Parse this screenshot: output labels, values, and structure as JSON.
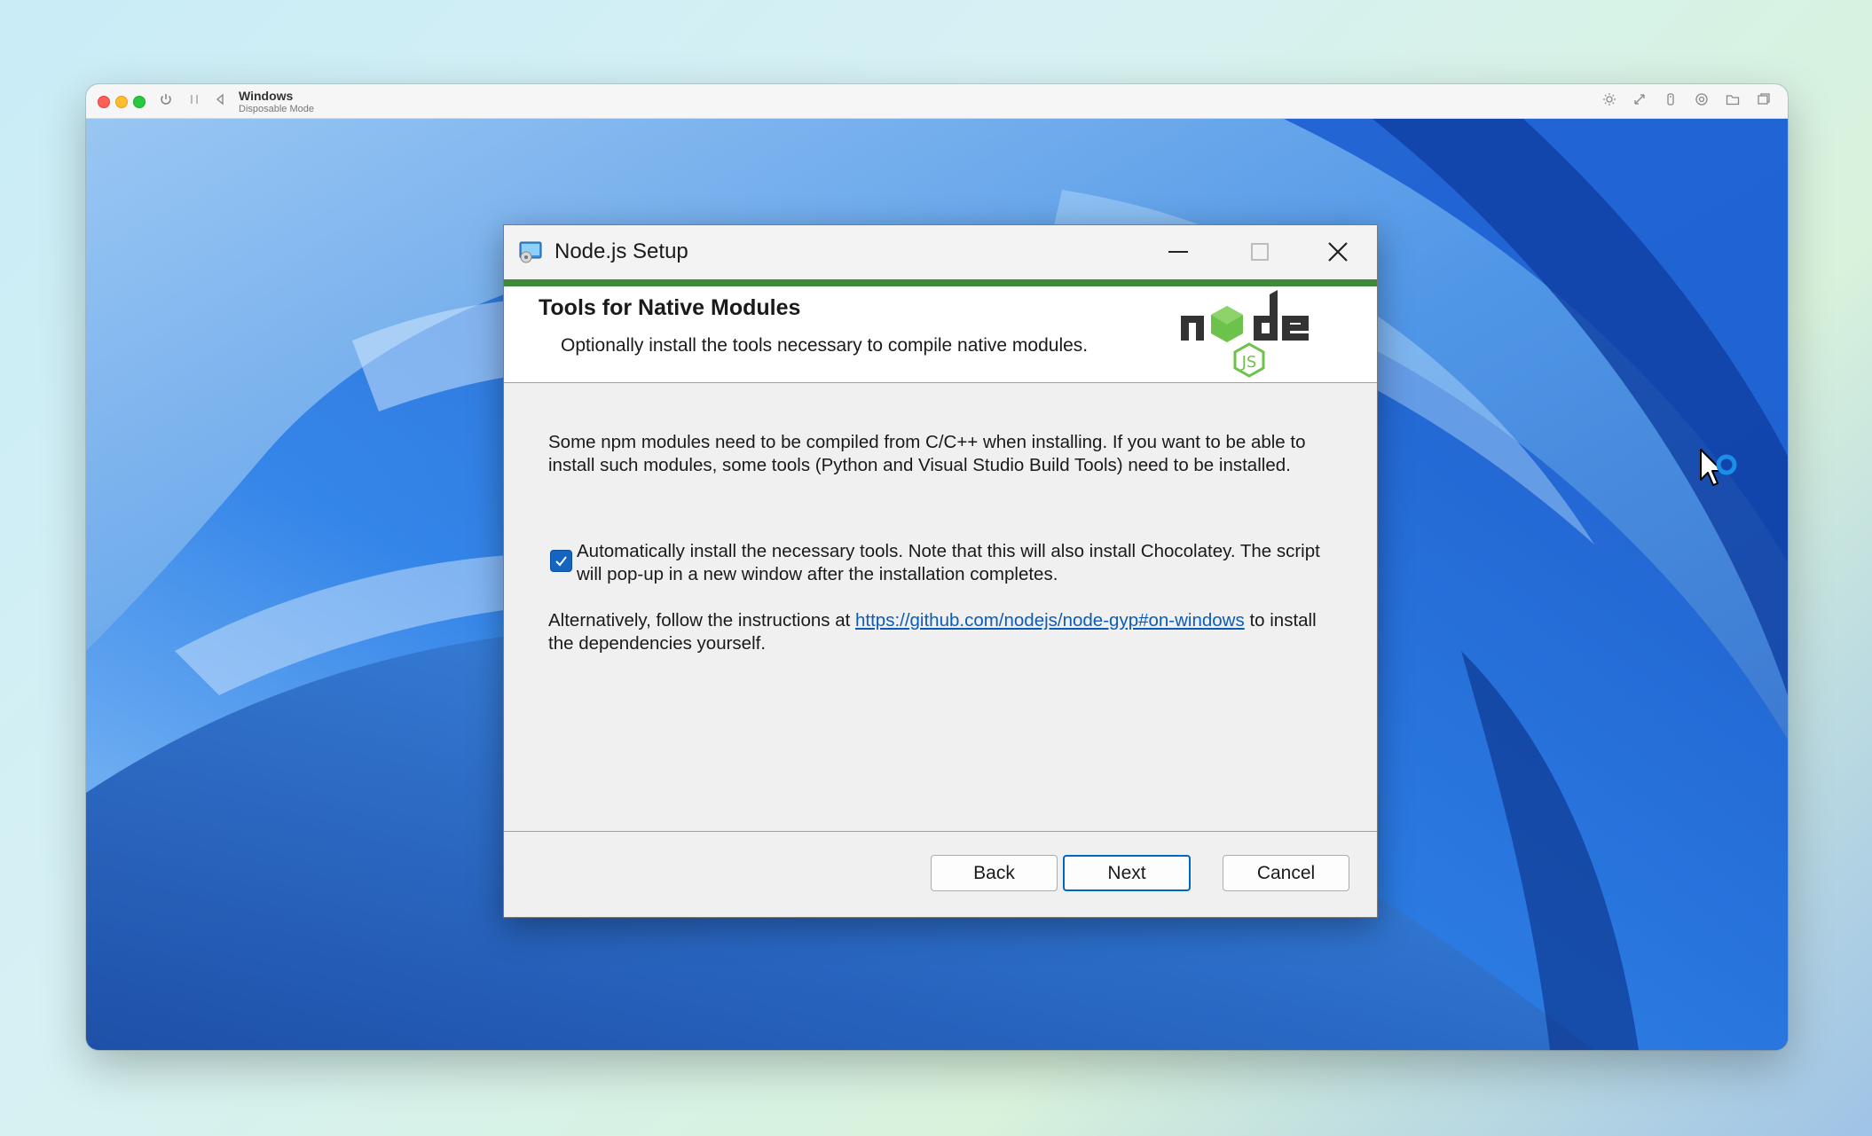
{
  "vm": {
    "name": "Windows",
    "mode": "Disposable Mode",
    "toolbar_icons": [
      "power-icon",
      "pause-icon",
      "back-icon",
      "brightness-icon",
      "resize-icon",
      "usb-icon",
      "settings-icon",
      "folder-icon",
      "window-icon"
    ]
  },
  "dialog": {
    "title": "Node.js Setup",
    "header": {
      "title": "Tools for Native Modules",
      "subtitle": "Optionally install the tools necessary to compile native modules."
    },
    "body": {
      "paragraph1": "Some npm modules need to be compiled from C/C++ when installing. If you want to be able to install such modules, some tools (Python and Visual Studio Build Tools) need to be installed.",
      "checkbox_label": "Automatically install the necessary tools. Note that this will also install Chocolatey. The script will pop-up in a new window after the installation completes.",
      "checkbox_checked": true,
      "alt_prefix": "Alternatively, follow the instructions at ",
      "alt_link": "https://github.com/nodejs/node-gyp#on-windows",
      "alt_suffix": " to install the dependencies yourself."
    },
    "buttons": {
      "back": "Back",
      "next": "Next",
      "cancel": "Cancel"
    },
    "colors": {
      "accent_green": "#3f8a3a",
      "checkbox_blue": "#1565c0",
      "link_blue": "#0b5cba",
      "focus_blue": "#0067c0"
    }
  }
}
